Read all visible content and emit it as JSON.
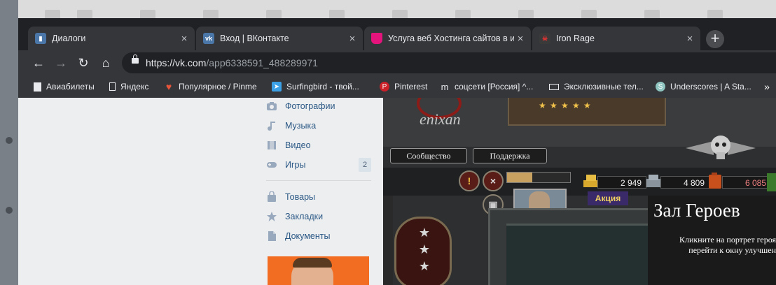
{
  "browser": {
    "tabs": [
      {
        "title": "Диалоги",
        "favicon": "vk-messages-icon",
        "favicon_color": "#4a76a8",
        "active": false
      },
      {
        "title": "Вход | ВКонтакте",
        "favicon": "vk-logo-icon",
        "favicon_color": "#4a76a8",
        "active": false
      },
      {
        "title": "Услуга веб Хостинга сайтов в и",
        "favicon": "hosting-icon",
        "favicon_color": "#e4147c",
        "active": false
      },
      {
        "title": "Iron Rage",
        "favicon": "iron-rage-icon",
        "favicon_color": "#8b1c18",
        "active": true
      }
    ],
    "new_tab_label": "+",
    "url_host": "https://vk.com",
    "url_path": "/app6338591_488289971",
    "bookmarks": [
      {
        "label": "Авиабилеты",
        "icon": "bookmark-folder-icon"
      },
      {
        "label": "Яндекс",
        "icon": "page-icon"
      },
      {
        "label": "Популярное / Pinme",
        "icon": "heart-icon"
      },
      {
        "label": "Surfingbird - твой...",
        "icon": "bird-icon"
      },
      {
        "label": "Pinterest",
        "icon": "pinterest-icon"
      },
      {
        "label": "соцсети [Россия] ^...",
        "icon": "m-icon"
      },
      {
        "label": "Эксклюзивные тел...",
        "icon": "card-icon"
      },
      {
        "label": "Underscores | A Sta...",
        "icon": "underscores-icon"
      }
    ]
  },
  "vk_menu": {
    "items": [
      {
        "label": "Фотографии",
        "icon": "camera-icon"
      },
      {
        "label": "Музыка",
        "icon": "music-icon"
      },
      {
        "label": "Видео",
        "icon": "film-icon"
      },
      {
        "label": "Игры",
        "icon": "gamepad-icon",
        "count": "2"
      },
      {
        "label": "Товары",
        "icon": "bag-icon"
      },
      {
        "label": "Закладки",
        "icon": "star-icon"
      },
      {
        "label": "Документы",
        "icon": "document-icon"
      }
    ]
  },
  "game": {
    "logo_text": "enixan",
    "community_button": "Сообщество",
    "support_button": "Поддержка",
    "resources": [
      {
        "value": "2 949",
        "icon": "gold-bars-icon"
      },
      {
        "value": "4 809",
        "icon": "metal-icon"
      },
      {
        "value": "6 085",
        "icon": "fuel-icon"
      }
    ],
    "promo_label": "Акция",
    "hall_title": "Зал Героев",
    "hall_hint_line1": "Кликните на портрет героя",
    "hall_hint_line2": "перейти к окну улучшен"
  }
}
